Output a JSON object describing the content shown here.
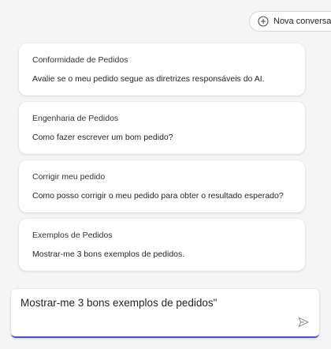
{
  "header": {
    "new_chat_label": "Nova conversa",
    "new_chat_icon": "add-chat-icon"
  },
  "suggestions": [
    {
      "title": "Conformidade de Pedidos",
      "description": "Avalie se o meu pedido segue as diretrizes responsáveis do AI."
    },
    {
      "title": "Engenharia de Pedidos",
      "description": "Como fazer escrever um bom pedido?"
    },
    {
      "title": "Corrigir meu pedido",
      "description": "Como posso corrigir o meu pedido para obter o resultado esperado?"
    },
    {
      "title": "Exemplos de Pedidos",
      "description": "Mostrar-me 3 bons exemplos de pedidos."
    }
  ],
  "composer": {
    "value": "Mostrar-me 3 bons exemplos de pedidos\"",
    "send_icon": "send-icon",
    "accent_color": "#4f52b2"
  }
}
